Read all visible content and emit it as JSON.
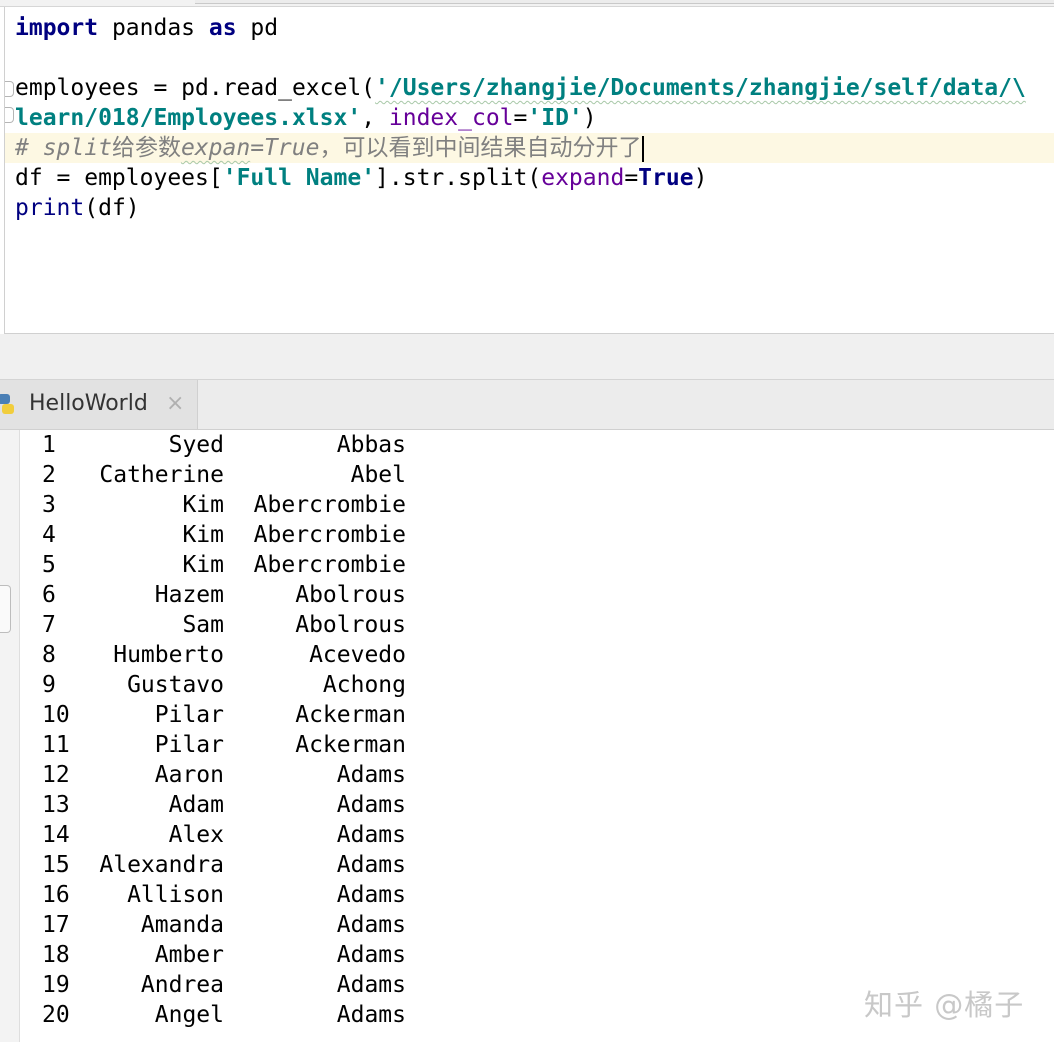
{
  "editor": {
    "line1": {
      "kw1": "import",
      "mid": " pandas ",
      "kw2": "as",
      "end": " pd"
    },
    "line3": {
      "start": "employees = pd.read_excel(",
      "path": "'/Users/zhangjie/Documents/zhangjie/self/data/\\"
    },
    "line4": {
      "path_end": "learn/018/Employees.xlsx'",
      "sep": ", ",
      "param": "index_col",
      "eq": "=",
      "val": "'ID'",
      "close": ")"
    },
    "line5": {
      "hash": "# split",
      "cjk1": "给参数",
      "expan": "expan",
      "eqtrue": "=True",
      "cjk2": "，可以看到中间结果自动分开了"
    },
    "line6": {
      "start": "df = employees[",
      "key": "'Full Name'",
      "mid": "].str.split(",
      "param": "expand",
      "eq": "=",
      "val": "True",
      "close": ")"
    },
    "line7": {
      "fn": "print",
      "args": "(df)"
    }
  },
  "tab": {
    "label": "HelloWorld",
    "close": "×"
  },
  "output": [
    {
      "idx": "1",
      "first": "Syed",
      "last": "Abbas"
    },
    {
      "idx": "2",
      "first": "Catherine",
      "last": "Abel"
    },
    {
      "idx": "3",
      "first": "Kim",
      "last": "Abercrombie"
    },
    {
      "idx": "4",
      "first": "Kim",
      "last": "Abercrombie"
    },
    {
      "idx": "5",
      "first": "Kim",
      "last": "Abercrombie"
    },
    {
      "idx": "6",
      "first": "Hazem",
      "last": "Abolrous"
    },
    {
      "idx": "7",
      "first": "Sam",
      "last": "Abolrous"
    },
    {
      "idx": "8",
      "first": "Humberto",
      "last": "Acevedo"
    },
    {
      "idx": "9",
      "first": "Gustavo",
      "last": "Achong"
    },
    {
      "idx": "10",
      "first": "Pilar",
      "last": "Ackerman"
    },
    {
      "idx": "11",
      "first": "Pilar",
      "last": "Ackerman"
    },
    {
      "idx": "12",
      "first": "Aaron",
      "last": "Adams"
    },
    {
      "idx": "13",
      "first": "Adam",
      "last": "Adams"
    },
    {
      "idx": "14",
      "first": "Alex",
      "last": "Adams"
    },
    {
      "idx": "15",
      "first": "Alexandra",
      "last": "Adams"
    },
    {
      "idx": "16",
      "first": "Allison",
      "last": "Adams"
    },
    {
      "idx": "17",
      "first": "Amanda",
      "last": "Adams"
    },
    {
      "idx": "18",
      "first": "Amber",
      "last": "Adams"
    },
    {
      "idx": "19",
      "first": "Andrea",
      "last": "Adams"
    },
    {
      "idx": "20",
      "first": "Angel",
      "last": "Adams"
    }
  ],
  "watermark": "知乎 @橘子",
  "colors": {
    "keyword": "#000080",
    "string": "#008080",
    "param": "#660099",
    "comment": "#808080",
    "current_line": "#fdf8e3"
  }
}
